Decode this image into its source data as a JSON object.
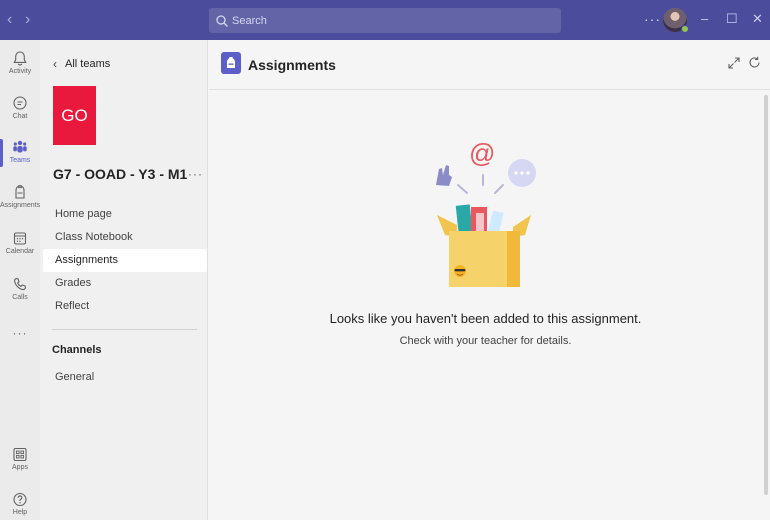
{
  "titlebar": {
    "search_placeholder": "Search",
    "more": "···"
  },
  "appbar": {
    "items": [
      {
        "label": "Activity",
        "icon": "bell-icon"
      },
      {
        "label": "Chat",
        "icon": "chat-icon"
      },
      {
        "label": "Teams",
        "icon": "teams-icon",
        "active": true
      },
      {
        "label": "Assignments",
        "icon": "assignments-icon"
      },
      {
        "label": "Calendar",
        "icon": "calendar-icon"
      },
      {
        "label": "Calls",
        "icon": "phone-icon"
      },
      {
        "label": "Apps",
        "icon": "apps-icon"
      },
      {
        "label": "Help",
        "icon": "help-icon"
      }
    ],
    "more": "···"
  },
  "sidebar": {
    "back_label": "All teams",
    "team_initials": "GO",
    "team_color": "#e8193c",
    "team_name": "G7 - OOAD - Y3 - M1",
    "team_more": "···",
    "tabs": [
      {
        "label": "Home page"
      },
      {
        "label": "Class Notebook"
      },
      {
        "label": "Assignments",
        "active": true
      },
      {
        "label": "Grades"
      },
      {
        "label": "Reflect"
      }
    ],
    "channels_heading": "Channels",
    "channels": [
      {
        "label": "General"
      }
    ]
  },
  "main": {
    "title": "Assignments",
    "accent": "#5b5fc7",
    "illustration_at": "@",
    "empty_title": "Looks like you haven't been added to this assignment.",
    "empty_subtitle": "Check with your teacher for details."
  }
}
